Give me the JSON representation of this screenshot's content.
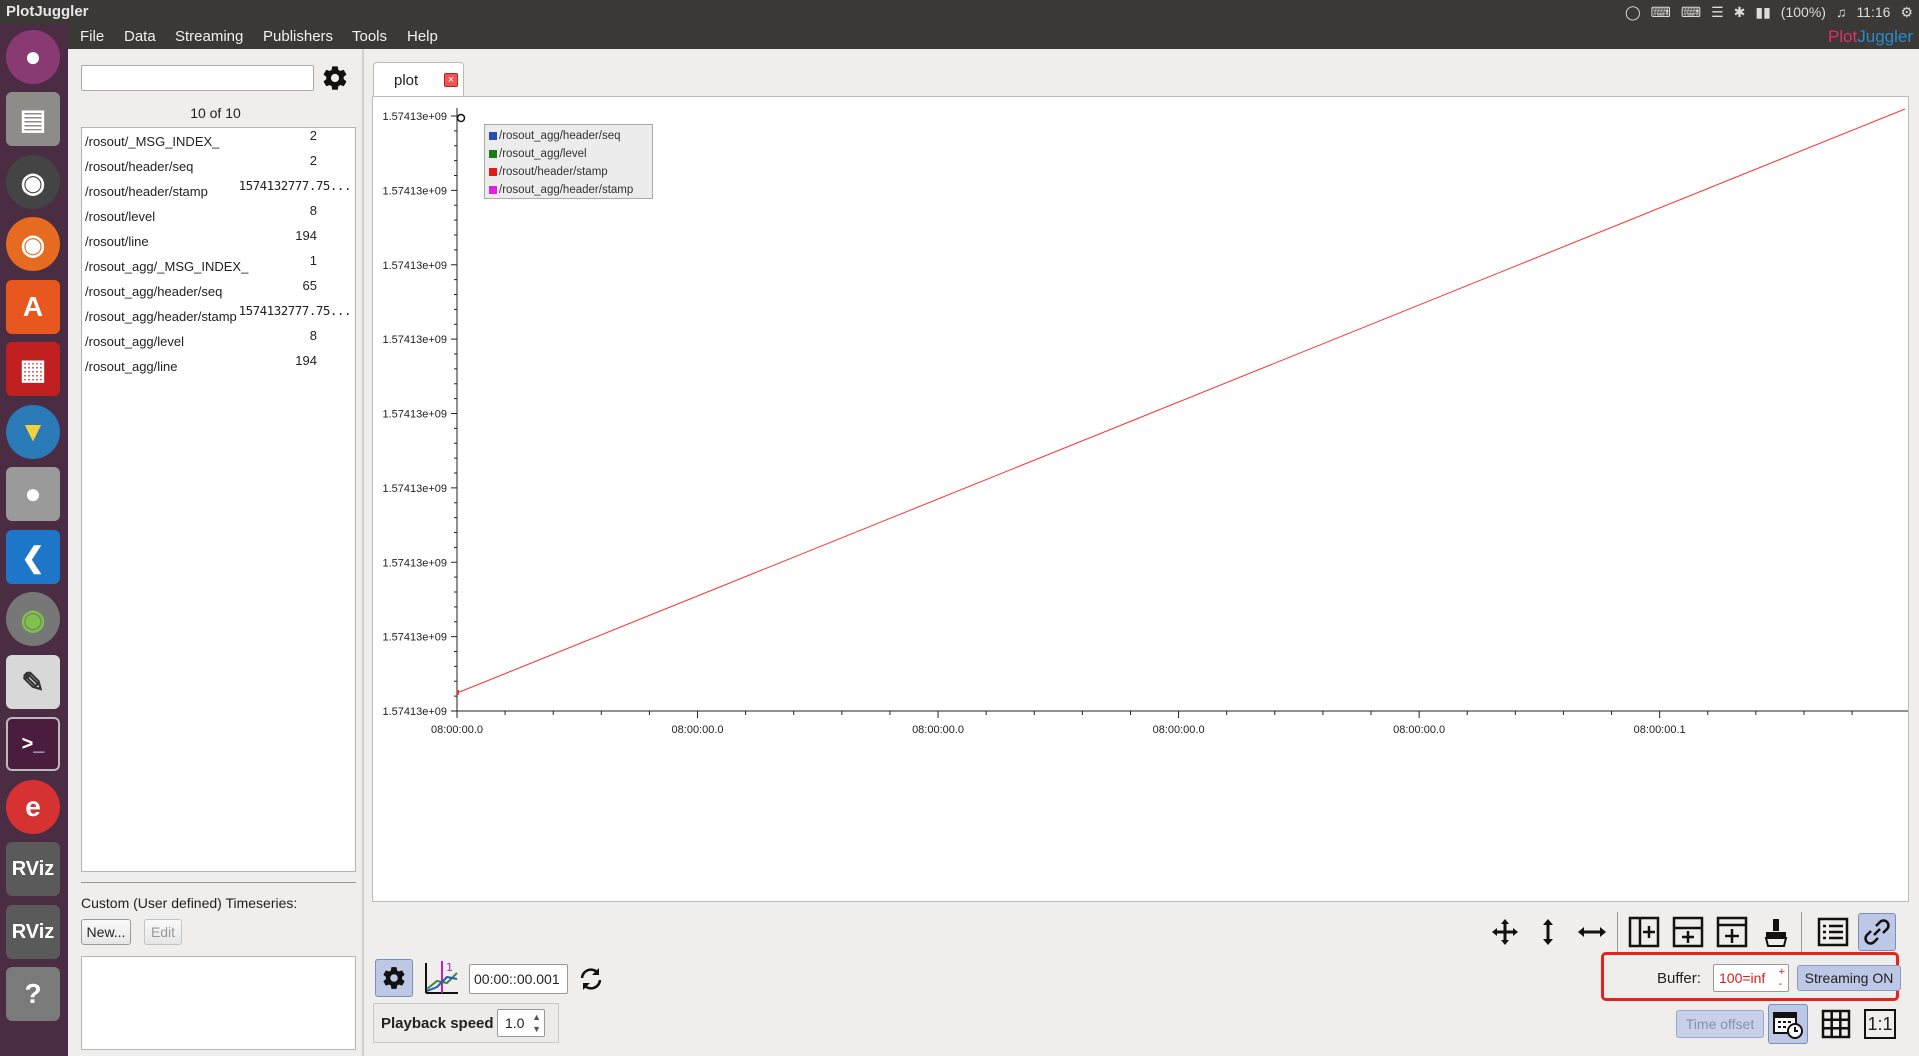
{
  "app": {
    "title": "PlotJuggler"
  },
  "tray": {
    "battery": "(100%)",
    "time": "11:16"
  },
  "menu": {
    "items": [
      "File",
      "Data",
      "Streaming",
      "Publishers",
      "Tools",
      "Help"
    ],
    "brand_plot": "Plot",
    "brand_juggler": "Juggler"
  },
  "dock": {
    "apps": [
      "ubuntu-icon",
      "files-icon",
      "disk-icon",
      "firefox-icon",
      "software-center-icon",
      "plotjuggler-icon",
      "lantern-icon",
      "camera-icon",
      "vscode-icon",
      "eye-icon",
      "text-editor-icon",
      "terminal-icon",
      "app-icon",
      "rviz-icon",
      "rviz-icon",
      "help-icon"
    ],
    "rviz_label": "RViz"
  },
  "timeseries": {
    "filter_placeholder": "",
    "count": "10 of 10",
    "items": [
      {
        "name": "/rosout/_MSG_INDEX_",
        "value": "2"
      },
      {
        "name": "/rosout/header/seq",
        "value": "2"
      },
      {
        "name": "/rosout/header/stamp",
        "value": "1574132777.75..."
      },
      {
        "name": "/rosout/level",
        "value": "8"
      },
      {
        "name": "/rosout/line",
        "value": "194"
      },
      {
        "name": "/rosout_agg/_MSG_INDEX_",
        "value": "1"
      },
      {
        "name": "/rosout_agg/header/seq",
        "value": "65"
      },
      {
        "name": "/rosout_agg/header/stamp",
        "value": "1574132777.75..."
      },
      {
        "name": "/rosout_agg/level",
        "value": "8"
      },
      {
        "name": "/rosout_agg/line",
        "value": "194"
      }
    ]
  },
  "custom": {
    "label": "Custom (User defined) Timeseries:",
    "new_label": "New...",
    "edit_label": "Edit"
  },
  "tabs": [
    {
      "label": "plot"
    }
  ],
  "legend": {
    "entries": [
      {
        "name": "/rosout_agg/header/seq",
        "color": "#1f4fb0"
      },
      {
        "name": "/rosout_agg/level",
        "color": "#1a7a1a"
      },
      {
        "name": "/rosout/header/stamp",
        "color": "#e01b1b"
      },
      {
        "name": "/rosout_agg/header/stamp",
        "color": "#e020e0"
      }
    ]
  },
  "chart_data": {
    "type": "line",
    "y_tick_labels": [
      "1.57413e+09",
      "1.57413e+09",
      "1.57413e+09",
      "1.57413e+09",
      "1.57413e+09",
      "1.57413e+09",
      "1.57413e+09",
      "1.57413e+09",
      "1.57413e+09"
    ],
    "x_tick_labels": [
      "08:00:00.0",
      "08:00:00.0",
      "08:00:00.0",
      "08:00:00.0",
      "08:00:00.0",
      "08:00:00.1"
    ],
    "series": [
      {
        "values_fraction_start": 0.0,
        "values_fraction_end": 1.0,
        "color": "#ff3030"
      }
    ],
    "grid": false,
    "legend_position": "top-left"
  },
  "playback": {
    "time": "00:00::00.001",
    "speed_label": "Playback speed",
    "speed": "1.0"
  },
  "streaming": {
    "buffer_label": "Buffer:",
    "buffer_value": "100=inf",
    "button": "Streaming ON",
    "time_offset": "Time offset",
    "ratio_label": "1:1"
  }
}
